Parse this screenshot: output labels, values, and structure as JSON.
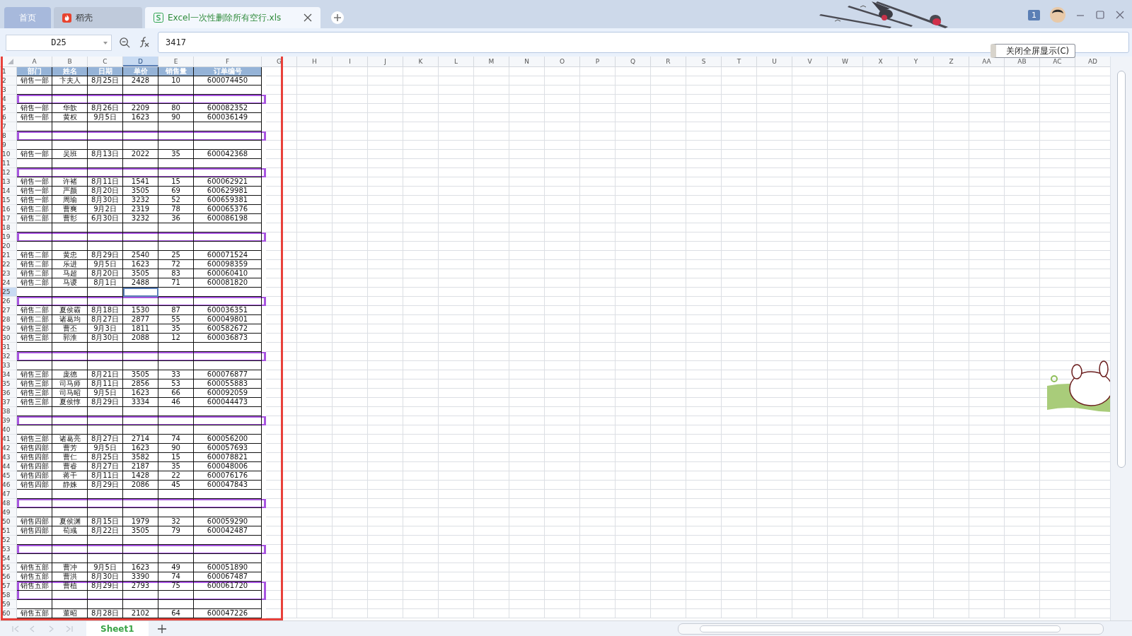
{
  "tabs": [
    {
      "label": "首页",
      "kind": "home",
      "selected": false
    },
    {
      "label": "稻壳",
      "kind": "docer",
      "selected": false
    },
    {
      "label": "Excel一次性删除所有空行.xls",
      "kind": "sheet",
      "selected": true
    }
  ],
  "account": {
    "badge": "1"
  },
  "formula_bar": {
    "name_box": "D25",
    "value": "3417"
  },
  "fullscreen_button": "关闭全屏显示(C)",
  "columns": [
    {
      "label": "A",
      "selected": false
    },
    {
      "label": "B",
      "selected": false
    },
    {
      "label": "C",
      "selected": false
    },
    {
      "label": "D",
      "selected": true
    },
    {
      "label": "E",
      "selected": false
    },
    {
      "label": "F",
      "selected": false
    },
    {
      "label": "G",
      "selected": false
    },
    {
      "label": "H",
      "selected": false
    },
    {
      "label": "I",
      "selected": false
    },
    {
      "label": "J",
      "selected": false
    },
    {
      "label": "K",
      "selected": false
    },
    {
      "label": "L",
      "selected": false
    },
    {
      "label": "M",
      "selected": false
    },
    {
      "label": "N",
      "selected": false
    },
    {
      "label": "O",
      "selected": false
    },
    {
      "label": "P",
      "selected": false
    },
    {
      "label": "Q",
      "selected": false
    },
    {
      "label": "R",
      "selected": false
    },
    {
      "label": "S",
      "selected": false
    },
    {
      "label": "T",
      "selected": false
    },
    {
      "label": "U",
      "selected": false
    },
    {
      "label": "V",
      "selected": false
    },
    {
      "label": "W",
      "selected": false
    },
    {
      "label": "X",
      "selected": false
    },
    {
      "label": "Y",
      "selected": false
    },
    {
      "label": "Z",
      "selected": false
    },
    {
      "label": "AA",
      "selected": false
    },
    {
      "label": "AB",
      "selected": false
    },
    {
      "label": "AC",
      "selected": false
    },
    {
      "label": "AD",
      "selected": false
    }
  ],
  "rows": [
    {
      "number": "1",
      "kind": "header",
      "highlighted": false,
      "selected": false,
      "cells": [
        "部门",
        "姓名",
        "日期",
        "单价",
        "销售量",
        "订单编号"
      ]
    },
    {
      "number": "2",
      "kind": "data",
      "highlighted": false,
      "selected": false,
      "cells": [
        "销售一部",
        "卞夫人",
        "8月25日",
        "2428",
        "10",
        "600074450"
      ]
    },
    {
      "number": "3",
      "kind": "data",
      "highlighted": false,
      "selected": false
    },
    {
      "number": "4",
      "kind": "data",
      "highlighted": true,
      "selected": false
    },
    {
      "number": "5",
      "kind": "data",
      "highlighted": false,
      "selected": false,
      "cells": [
        "销售一部",
        "华歆",
        "8月26日",
        "2209",
        "80",
        "600082352"
      ]
    },
    {
      "number": "6",
      "kind": "data",
      "highlighted": false,
      "selected": false,
      "cells": [
        "销售一部",
        "黄权",
        "9月5日",
        "1623",
        "90",
        "600036149"
      ]
    },
    {
      "number": "7",
      "kind": "data",
      "highlighted": false,
      "selected": false
    },
    {
      "number": "8",
      "kind": "data",
      "highlighted": true,
      "selected": false
    },
    {
      "number": "9",
      "kind": "data",
      "highlighted": false,
      "selected": false
    },
    {
      "number": "10",
      "kind": "data",
      "highlighted": false,
      "selected": false,
      "cells": [
        "销售一部",
        "吴班",
        "8月13日",
        "2022",
        "35",
        "600042368"
      ]
    },
    {
      "number": "11",
      "kind": "data",
      "highlighted": false,
      "selected": false
    },
    {
      "number": "12",
      "kind": "data",
      "highlighted": true,
      "selected": false
    },
    {
      "number": "13",
      "kind": "data",
      "highlighted": false,
      "selected": false,
      "cells": [
        "销售一部",
        "许褚",
        "8月11日",
        "1541",
        "15",
        "600062921"
      ]
    },
    {
      "number": "14",
      "kind": "data",
      "highlighted": false,
      "selected": false,
      "cells": [
        "销售一部",
        "严颜",
        "8月20日",
        "3505",
        "69",
        "600629981"
      ]
    },
    {
      "number": "15",
      "kind": "data",
      "highlighted": false,
      "selected": false,
      "cells": [
        "销售一部",
        "周瑜",
        "8月30日",
        "3232",
        "52",
        "600659381"
      ]
    },
    {
      "number": "16",
      "kind": "data",
      "highlighted": false,
      "selected": false,
      "cells": [
        "销售二部",
        "曹爽",
        "9月2日",
        "2319",
        "78",
        "600065376"
      ]
    },
    {
      "number": "17",
      "kind": "data",
      "highlighted": false,
      "selected": false,
      "cells": [
        "销售二部",
        "曹彰",
        "6月30日",
        "3232",
        "36",
        "600086198"
      ]
    },
    {
      "number": "18",
      "kind": "data",
      "highlighted": false,
      "selected": false
    },
    {
      "number": "19",
      "kind": "data",
      "highlighted": true,
      "selected": false
    },
    {
      "number": "20",
      "kind": "data",
      "highlighted": false,
      "selected": false
    },
    {
      "number": "21",
      "kind": "data",
      "highlighted": false,
      "selected": false,
      "cells": [
        "销售二部",
        "黄忠",
        "8月29日",
        "2540",
        "25",
        "600071524"
      ]
    },
    {
      "number": "22",
      "kind": "data",
      "highlighted": false,
      "selected": false,
      "cells": [
        "销售二部",
        "乐进",
        "9月5日",
        "1623",
        "72",
        "600098359"
      ]
    },
    {
      "number": "23",
      "kind": "data",
      "highlighted": false,
      "selected": false,
      "cells": [
        "销售二部",
        "马超",
        "8月20日",
        "3505",
        "83",
        "600060410"
      ]
    },
    {
      "number": "24",
      "kind": "data",
      "highlighted": false,
      "selected": false,
      "cells": [
        "销售二部",
        "马谡",
        "8月1日",
        "2488",
        "71",
        "600081820"
      ]
    },
    {
      "number": "25",
      "kind": "data",
      "highlighted": false,
      "selected": true
    },
    {
      "number": "26",
      "kind": "data",
      "highlighted": true,
      "selected": false
    },
    {
      "number": "27",
      "kind": "data",
      "highlighted": false,
      "selected": false,
      "cells": [
        "销售二部",
        "夏侯霸",
        "8月18日",
        "1530",
        "87",
        "600036351"
      ]
    },
    {
      "number": "28",
      "kind": "data",
      "highlighted": false,
      "selected": false,
      "cells": [
        "销售二部",
        "诸葛均",
        "8月27日",
        "2877",
        "55",
        "600049801"
      ]
    },
    {
      "number": "29",
      "kind": "data",
      "highlighted": false,
      "selected": false,
      "cells": [
        "销售三部",
        "曹丕",
        "9月3日",
        "1811",
        "35",
        "600582672"
      ]
    },
    {
      "number": "30",
      "kind": "data",
      "highlighted": false,
      "selected": false,
      "cells": [
        "销售三部",
        "郭淮",
        "8月30日",
        "2088",
        "12",
        "600036873"
      ]
    },
    {
      "number": "31",
      "kind": "data",
      "highlighted": false,
      "selected": false
    },
    {
      "number": "32",
      "kind": "data",
      "highlighted": true,
      "selected": false
    },
    {
      "number": "33",
      "kind": "data",
      "highlighted": false,
      "selected": false
    },
    {
      "number": "34",
      "kind": "data",
      "highlighted": false,
      "selected": false,
      "cells": [
        "销售三部",
        "庞德",
        "8月21日",
        "3505",
        "33",
        "600076877"
      ]
    },
    {
      "number": "35",
      "kind": "data",
      "highlighted": false,
      "selected": false,
      "cells": [
        "销售三部",
        "司马师",
        "8月11日",
        "2856",
        "53",
        "600055883"
      ]
    },
    {
      "number": "36",
      "kind": "data",
      "highlighted": false,
      "selected": false,
      "cells": [
        "销售三部",
        "司马昭",
        "9月5日",
        "1623",
        "66",
        "600092059"
      ]
    },
    {
      "number": "37",
      "kind": "data",
      "highlighted": false,
      "selected": false,
      "cells": [
        "销售三部",
        "夏侯惇",
        "8月29日",
        "3334",
        "46",
        "600044473"
      ]
    },
    {
      "number": "38",
      "kind": "data",
      "highlighted": false,
      "selected": false
    },
    {
      "number": "39",
      "kind": "data",
      "highlighted": true,
      "selected": false
    },
    {
      "number": "40",
      "kind": "data",
      "highlighted": false,
      "selected": false
    },
    {
      "number": "41",
      "kind": "data",
      "highlighted": false,
      "selected": false,
      "cells": [
        "销售三部",
        "诸葛亮",
        "8月27日",
        "2714",
        "74",
        "600056200"
      ]
    },
    {
      "number": "42",
      "kind": "data",
      "highlighted": false,
      "selected": false,
      "cells": [
        "销售四部",
        "曹芳",
        "9月5日",
        "1623",
        "90",
        "600057693"
      ]
    },
    {
      "number": "43",
      "kind": "data",
      "highlighted": false,
      "selected": false,
      "cells": [
        "销售四部",
        "曹仁",
        "8月25日",
        "3582",
        "15",
        "600078821"
      ]
    },
    {
      "number": "44",
      "kind": "data",
      "highlighted": false,
      "selected": false,
      "cells": [
        "销售四部",
        "曹睿",
        "8月27日",
        "2187",
        "35",
        "600048006"
      ]
    },
    {
      "number": "45",
      "kind": "data",
      "highlighted": false,
      "selected": false,
      "cells": [
        "销售四部",
        "蒋干",
        "8月11日",
        "1428",
        "22",
        "600076176"
      ]
    },
    {
      "number": "46",
      "kind": "data",
      "highlighted": false,
      "selected": false,
      "cells": [
        "销售四部",
        "静姝",
        "8月29日",
        "2086",
        "45",
        "600047843"
      ]
    },
    {
      "number": "47",
      "kind": "data",
      "highlighted": false,
      "selected": false
    },
    {
      "number": "48",
      "kind": "data",
      "highlighted": true,
      "selected": false
    },
    {
      "number": "49",
      "kind": "data",
      "highlighted": false,
      "selected": false
    },
    {
      "number": "50",
      "kind": "data",
      "highlighted": false,
      "selected": false,
      "cells": [
        "销售四部",
        "夏侯渊",
        "8月15日",
        "1979",
        "32",
        "600059290"
      ]
    },
    {
      "number": "51",
      "kind": "data",
      "highlighted": false,
      "selected": false,
      "cells": [
        "销售四部",
        "荀彧",
        "8月22日",
        "3505",
        "79",
        "600042487"
      ]
    },
    {
      "number": "52",
      "kind": "data",
      "highlighted": false,
      "selected": false
    },
    {
      "number": "53",
      "kind": "data",
      "highlighted": true,
      "selected": false
    },
    {
      "number": "54",
      "kind": "data",
      "highlighted": false,
      "selected": false
    },
    {
      "number": "55",
      "kind": "data",
      "highlighted": false,
      "selected": false,
      "cells": [
        "销售五部",
        "曹冲",
        "9月5日",
        "1623",
        "49",
        "600051890"
      ]
    },
    {
      "number": "56",
      "kind": "data",
      "highlighted": false,
      "selected": false,
      "cells": [
        "销售五部",
        "曹洪",
        "8月30日",
        "3390",
        "74",
        "600067487"
      ]
    },
    {
      "number": "57",
      "kind": "data",
      "highlighted": true,
      "selected": false,
      "cells": [
        "销售五部",
        "曹植",
        "8月29日",
        "2793",
        "75",
        "600061720"
      ]
    },
    {
      "number": "58",
      "kind": "data",
      "highlighted": true,
      "selected": false
    },
    {
      "number": "59",
      "kind": "data",
      "highlighted": false,
      "selected": false
    },
    {
      "number": "60",
      "kind": "data",
      "highlighted": false,
      "selected": false,
      "cells": [
        "销售五部",
        "董昭",
        "8月28日",
        "2102",
        "64",
        "600047226"
      ]
    }
  ],
  "sheet_tabs": [
    {
      "label": "Sheet1",
      "selected": true
    }
  ]
}
